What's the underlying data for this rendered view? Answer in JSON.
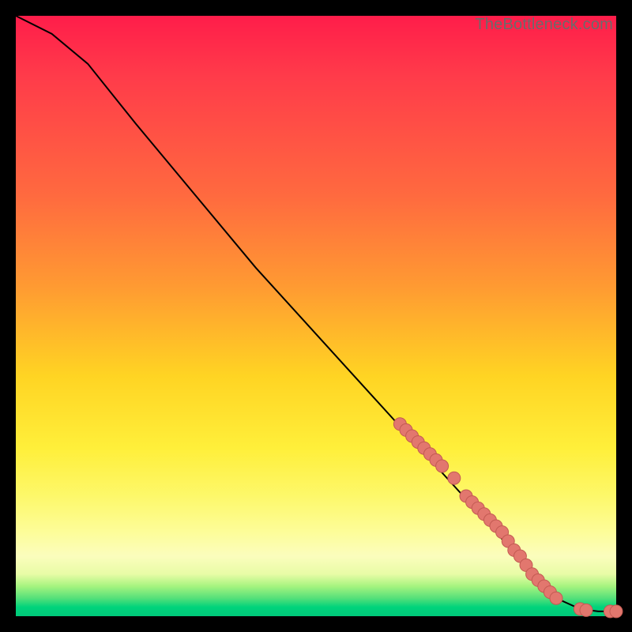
{
  "attribution": "TheBottleneck.com",
  "chart_data": {
    "type": "line",
    "title": "",
    "xlabel": "",
    "ylabel": "",
    "xlim": [
      0,
      100
    ],
    "ylim": [
      0,
      100
    ],
    "curve": {
      "name": "bottleneck-curve",
      "points": [
        {
          "x": 0,
          "y": 100
        },
        {
          "x": 6,
          "y": 97
        },
        {
          "x": 12,
          "y": 92
        },
        {
          "x": 20,
          "y": 82
        },
        {
          "x": 30,
          "y": 70
        },
        {
          "x": 40,
          "y": 58
        },
        {
          "x": 50,
          "y": 47
        },
        {
          "x": 60,
          "y": 36
        },
        {
          "x": 70,
          "y": 25
        },
        {
          "x": 80,
          "y": 14
        },
        {
          "x": 86,
          "y": 7
        },
        {
          "x": 90,
          "y": 3
        },
        {
          "x": 94,
          "y": 1.2
        },
        {
          "x": 97,
          "y": 0.8
        },
        {
          "x": 100,
          "y": 0.8
        }
      ]
    },
    "series": [
      {
        "name": "cluster-points",
        "type": "scatter",
        "marker_color": "#e2776e",
        "points": [
          {
            "x": 64,
            "y": 32
          },
          {
            "x": 65,
            "y": 31
          },
          {
            "x": 66,
            "y": 30
          },
          {
            "x": 67,
            "y": 29
          },
          {
            "x": 68,
            "y": 28
          },
          {
            "x": 69,
            "y": 27
          },
          {
            "x": 70,
            "y": 26
          },
          {
            "x": 71,
            "y": 25
          },
          {
            "x": 73,
            "y": 23
          },
          {
            "x": 75,
            "y": 20
          },
          {
            "x": 76,
            "y": 19
          },
          {
            "x": 77,
            "y": 18
          },
          {
            "x": 78,
            "y": 17
          },
          {
            "x": 79,
            "y": 16
          },
          {
            "x": 80,
            "y": 15
          },
          {
            "x": 81,
            "y": 14
          },
          {
            "x": 82,
            "y": 12.5
          },
          {
            "x": 83,
            "y": 11
          },
          {
            "x": 84,
            "y": 10
          },
          {
            "x": 85,
            "y": 8.5
          },
          {
            "x": 86,
            "y": 7
          },
          {
            "x": 87,
            "y": 6
          },
          {
            "x": 88,
            "y": 5
          },
          {
            "x": 89,
            "y": 4
          },
          {
            "x": 90,
            "y": 3
          },
          {
            "x": 94,
            "y": 1.2
          },
          {
            "x": 95,
            "y": 1.0
          },
          {
            "x": 99,
            "y": 0.8
          },
          {
            "x": 100,
            "y": 0.8
          }
        ]
      }
    ]
  }
}
